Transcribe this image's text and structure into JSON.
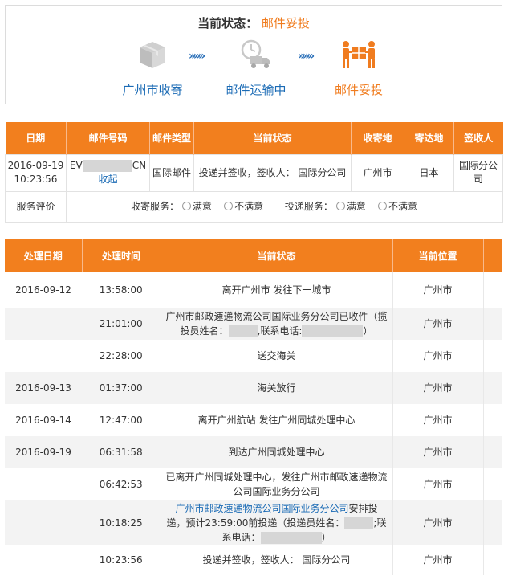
{
  "status_panel": {
    "title_label": "当前状态：",
    "title_value": "邮件妥投",
    "steps": [
      {
        "label": "广州市收寄",
        "icon": "package-icon"
      },
      {
        "label": "邮件运输中",
        "icon": "delivery-truck-icon"
      },
      {
        "label": "邮件妥投",
        "icon": "hand-over-icon"
      }
    ],
    "arrow": "»»»"
  },
  "info_table": {
    "headers": [
      "日期",
      "邮件号码",
      "邮件类型",
      "当前状态",
      "收寄地",
      "寄达地",
      "签收人"
    ],
    "row": {
      "date": "2016-09-19 10:23:56",
      "tracking_prefix": "EV",
      "tracking_suffix": "CN",
      "collapse_link": "收起",
      "mail_type": "国际邮件",
      "status": "投递并签收，签收人： 国际分公司",
      "origin": "广州市",
      "destination": "日本",
      "signer": "国际分公司"
    },
    "rating": {
      "label": "服务评价",
      "collect_label": "收寄服务：",
      "deliver_label": "投递服务：",
      "option_satisfied": "满意",
      "option_unsatisfied": "不满意"
    }
  },
  "track_table": {
    "headers": [
      "处理日期",
      "处理时间",
      "当前状态",
      "当前位置"
    ],
    "rows": [
      {
        "date": "2016-09-12",
        "time": "13:58:00",
        "status": "离开广州市 发往下一城市",
        "location": "广州市"
      },
      {
        "date": "",
        "time": "21:01:00",
        "status_a": "广州市邮政速递物流公司国际业务分公司已收件（揽投员姓名：",
        "status_b": ",联系电话:",
        "status_c": "）",
        "location": "广州市"
      },
      {
        "date": "",
        "time": "22:28:00",
        "status": "送交海关",
        "location": "广州市"
      },
      {
        "date": "2016-09-13",
        "time": "01:37:00",
        "status": "海关放行",
        "location": "广州市"
      },
      {
        "date": "2016-09-14",
        "time": "12:47:00",
        "status": "离开广州航站 发往广州同城处理中心",
        "location": "广州市"
      },
      {
        "date": "2016-09-19",
        "time": "06:31:58",
        "status": "到达广州同城处理中心",
        "location": "广州市"
      },
      {
        "date": "",
        "time": "06:42:53",
        "status": "已离开广州同城处理中心，发往广州市邮政速递物流公司国际业务分公司",
        "location": "广州市"
      },
      {
        "date": "",
        "time": "10:18:25",
        "status_link": "广州市邮政速递物流公司国际业务分公司",
        "status_a": "安排投递，预计23:59:00前投递（投递员姓名：",
        "status_b": ";联系电话：",
        "status_c": "）",
        "location": "广州市"
      },
      {
        "date": "",
        "time": "10:23:56",
        "status": "投递并签收，签收人： 国际分公司",
        "location": "广州市"
      }
    ]
  }
}
